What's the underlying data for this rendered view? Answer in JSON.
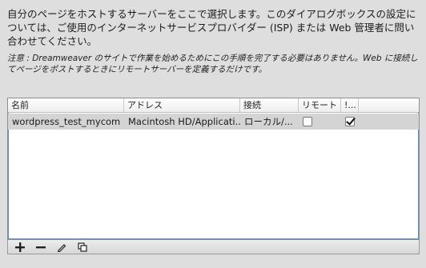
{
  "intro_text": "自分のページをホストするサーバーをここで選択します。このダイアログボックスの設定については、ご使用のインターネットサービスプロバイダー (ISP) または Web 管理者に問い合わせてください。",
  "note_text": "注意 : Dreamweaver のサイトで作業を始めるためにこの手順を完了する必要はありません。Web に接続してページをポストするときにリモートサーバーを定義するだけです。",
  "table": {
    "headers": [
      "名前",
      "アドレス",
      "接続",
      "リモート",
      "!..."
    ],
    "rows": [
      {
        "name": "wordpress_test_mycom",
        "address": "Macintosh HD/Applicati...",
        "connection": "ローカル/...",
        "remote": false,
        "testing": true
      }
    ]
  },
  "toolbar": {
    "icons": [
      "plus-icon",
      "minus-icon",
      "pencil-icon",
      "duplicate-icon"
    ]
  }
}
